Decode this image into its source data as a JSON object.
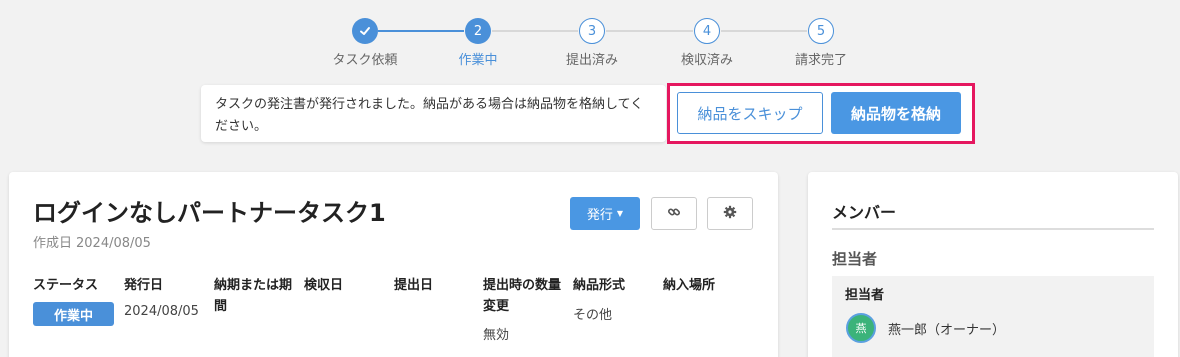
{
  "stepper": {
    "steps": [
      {
        "label": "タスク依頼",
        "marker": "",
        "state": "done"
      },
      {
        "label": "作業中",
        "marker": "2",
        "state": "current"
      },
      {
        "label": "提出済み",
        "marker": "3",
        "state": "todo"
      },
      {
        "label": "検収済み",
        "marker": "4",
        "state": "todo"
      },
      {
        "label": "請求完了",
        "marker": "5",
        "state": "todo"
      }
    ],
    "check_icon": "check-icon"
  },
  "notice": {
    "message": "タスクの発注書が発行されました。納品がある場合は納品物を格納してください。",
    "skip_label": "納品をスキップ",
    "store_label": "納品物を格納"
  },
  "task": {
    "title": "ログインなしパートナータスク1",
    "created_label": "作成日",
    "created_date": "2024/08/05",
    "publish_label": "発行",
    "link_icon": "link-icon",
    "settings_icon": "gear-icon",
    "columns": [
      {
        "header": "ステータス",
        "value": ""
      },
      {
        "header": "発行日",
        "value": "2024/08/05"
      },
      {
        "header": "納期または期間",
        "value": ""
      },
      {
        "header": "検収日",
        "value": ""
      },
      {
        "header": "提出日",
        "value": ""
      },
      {
        "header": "提出時の数量変更",
        "value": "無効"
      },
      {
        "header": "納品形式",
        "value": "その他"
      },
      {
        "header": "納入場所",
        "value": ""
      }
    ],
    "status_badge": "作業中"
  },
  "members": {
    "title": "メンバー",
    "assignee_heading": "担当者",
    "panel_title": "担当者",
    "avatar_text": "燕",
    "member_name": "燕一郎（オーナー）"
  },
  "colors": {
    "accent": "#4a90d9",
    "highlight": "#e5175f"
  }
}
